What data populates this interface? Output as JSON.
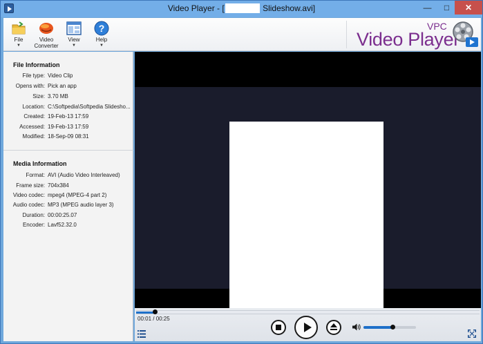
{
  "window": {
    "title_prefix": "Video Player - [",
    "title_suffix": "Slideshow.avi]",
    "min_glyph": "—",
    "max_glyph": "□",
    "close_glyph": "✕"
  },
  "toolbar": {
    "buttons": [
      {
        "label": "File",
        "icon": "folder-icon"
      },
      {
        "label": "Video Converter",
        "icon": "converter-icon"
      },
      {
        "label": "View",
        "icon": "view-icon"
      },
      {
        "label": "Help",
        "icon": "help-icon"
      }
    ],
    "dropdown_glyph": "▼",
    "brand_vpc": "VPC",
    "brand_name": "Video Player"
  },
  "file_info": {
    "title": "File Information",
    "rows": [
      {
        "label": "File type:",
        "value": "Video Clip"
      },
      {
        "label": "Opens with:",
        "value": "Pick an app"
      },
      {
        "label": "Size:",
        "value": "3.70 MB"
      },
      {
        "label": "Location:",
        "value": "C:\\Softpedia\\Softpedia Slidesho..."
      },
      {
        "label": "Created:",
        "value": "19-Feb-13 17:59"
      },
      {
        "label": "Accessed:",
        "value": "19-Feb-13 17:59"
      },
      {
        "label": "Modified:",
        "value": "18-Sep-09 08:31"
      }
    ]
  },
  "media_info": {
    "title": "Media Information",
    "rows": [
      {
        "label": "Format:",
        "value": "AVI (Audio Video Interleaved)"
      },
      {
        "label": "Frame size:",
        "value": "704x384"
      },
      {
        "label": "Video codec:",
        "value": "mpeg4 (MPEG-4 part 2)"
      },
      {
        "label": "Audio codec:",
        "value": "MP3 (MPEG audio layer 3)"
      },
      {
        "label": "Duration:",
        "value": "00:00:25.07"
      },
      {
        "label": "Encoder:",
        "value": "Lavf52.32.0"
      }
    ]
  },
  "player": {
    "time_display": "00:01 / 00:25",
    "progress_fraction": 0.055,
    "volume_fraction": 0.55,
    "accent_color": "#1e70c9"
  }
}
